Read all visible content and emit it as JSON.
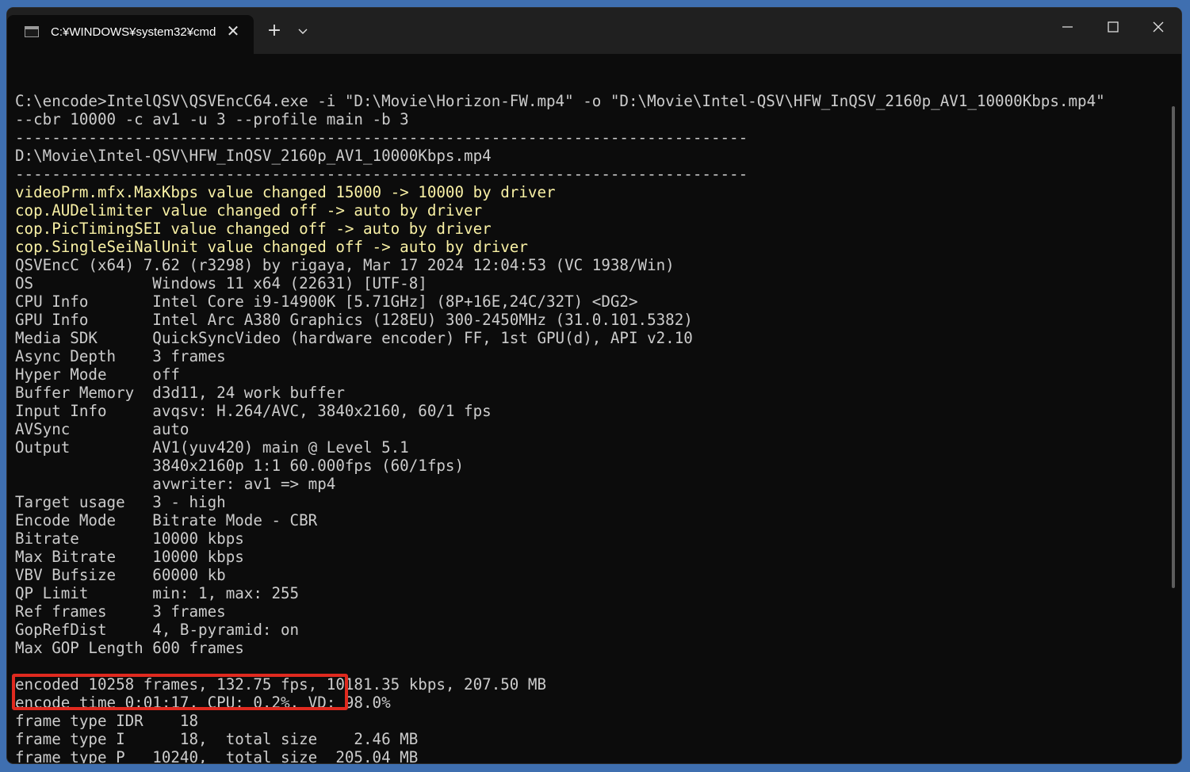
{
  "window": {
    "tab_title": "C:¥WINDOWS¥system32¥cmd",
    "new_tab_label": "+",
    "close_tab_label": "✕"
  },
  "terminal": {
    "lines": [
      {
        "text": "C:\\encode>IntelQSV\\QSVEncC64.exe -i \"D:\\Movie\\Horizon-FW.mp4\" -o \"D:\\Movie\\Intel-QSV\\HFW_InQSV_2160p_AV1_10000Kbps.mp4\"",
        "style": "normal"
      },
      {
        "text": "--cbr 10000 -c av1 -u 3 --profile main -b 3",
        "style": "normal"
      },
      {
        "text": "--------------------------------------------------------------------------------",
        "style": "normal"
      },
      {
        "text": "D:\\Movie\\Intel-QSV\\HFW_InQSV_2160p_AV1_10000Kbps.mp4",
        "style": "normal"
      },
      {
        "text": "--------------------------------------------------------------------------------",
        "style": "normal"
      },
      {
        "text": "videoPrm.mfx.MaxKbps value changed 15000 -> 10000 by driver",
        "style": "warn"
      },
      {
        "text": "cop.AUDelimiter value changed off -> auto by driver",
        "style": "warn"
      },
      {
        "text": "cop.PicTimingSEI value changed off -> auto by driver",
        "style": "warn"
      },
      {
        "text": "cop.SingleSeiNalUnit value changed off -> auto by driver",
        "style": "warn"
      },
      {
        "text": "QSVEncC (x64) 7.62 (r3298) by rigaya, Mar 17 2024 12:04:53 (VC 1938/Win)",
        "style": "normal"
      },
      {
        "text": "OS             Windows 11 x64 (22631) [UTF-8]",
        "style": "normal"
      },
      {
        "text": "CPU Info       Intel Core i9-14900K [5.71GHz] (8P+16E,24C/32T) <DG2>",
        "style": "normal"
      },
      {
        "text": "GPU Info       Intel Arc A380 Graphics (128EU) 300-2450MHz (31.0.101.5382)",
        "style": "normal"
      },
      {
        "text": "Media SDK      QuickSyncVideo (hardware encoder) FF, 1st GPU(d), API v2.10",
        "style": "normal"
      },
      {
        "text": "Async Depth    3 frames",
        "style": "normal"
      },
      {
        "text": "Hyper Mode     off",
        "style": "normal"
      },
      {
        "text": "Buffer Memory  d3d11, 24 work buffer",
        "style": "normal"
      },
      {
        "text": "Input Info     avqsv: H.264/AVC, 3840x2160, 60/1 fps",
        "style": "normal"
      },
      {
        "text": "AVSync         auto",
        "style": "normal"
      },
      {
        "text": "Output         AV1(yuv420) main @ Level 5.1",
        "style": "normal"
      },
      {
        "text": "               3840x2160p 1:1 60.000fps (60/1fps)",
        "style": "normal"
      },
      {
        "text": "               avwriter: av1 => mp4",
        "style": "normal"
      },
      {
        "text": "Target usage   3 - high",
        "style": "normal"
      },
      {
        "text": "Encode Mode    Bitrate Mode - CBR",
        "style": "normal"
      },
      {
        "text": "Bitrate        10000 kbps",
        "style": "normal"
      },
      {
        "text": "Max Bitrate    10000 kbps",
        "style": "normal"
      },
      {
        "text": "VBV Bufsize    60000 kb",
        "style": "normal"
      },
      {
        "text": "QP Limit       min: 1, max: 255",
        "style": "normal"
      },
      {
        "text": "Ref frames     3 frames",
        "style": "normal"
      },
      {
        "text": "GopRefDist     4, B-pyramid: on",
        "style": "normal"
      },
      {
        "text": "Max GOP Length 600 frames",
        "style": "normal"
      },
      {
        "text": "",
        "style": "normal"
      },
      {
        "text": "encoded 10258 frames, 132.75 fps, 10181.35 kbps, 207.50 MB",
        "style": "normal"
      },
      {
        "text": "encode time 0:01:17, CPU: 0.2%, VD: 98.0%",
        "style": "normal"
      },
      {
        "text": "frame type IDR    18",
        "style": "normal"
      },
      {
        "text": "frame type I      18,  total size    2.46 MB",
        "style": "normal"
      },
      {
        "text": "frame type P   10240,  total size  205.04 MB",
        "style": "normal"
      }
    ]
  },
  "colors": {
    "background": "#0c0c0c",
    "text": "#cccccc",
    "warning_text": "#f9f1a5",
    "highlight_box": "#e02a1f"
  }
}
